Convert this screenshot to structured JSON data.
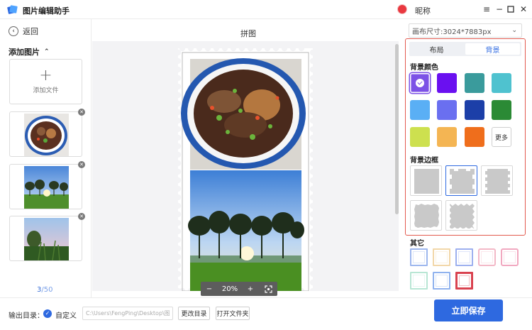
{
  "app": {
    "title": "图片编辑助手",
    "user_name": "昵称"
  },
  "window_controls": [
    "menu",
    "minimize",
    "maximize",
    "close"
  ],
  "left_panel": {
    "back_label": "返回",
    "add_images_label": "添加图片",
    "add_file_label": "添加文件",
    "thumbnails": [
      "food-bowl-photo",
      "sunset-trees-photo",
      "corn-field-photo"
    ],
    "page_current": "3",
    "page_total": "/50"
  },
  "canvas": {
    "title": "拼图",
    "zoom_minus": "−",
    "zoom_level": "20%",
    "zoom_plus": "+"
  },
  "bottom_bar": {
    "output_label": "输出目录：",
    "custom_label": "自定义",
    "path_value": "C:\\Users\\FengPing\\Desktop\\图片",
    "change_dir_label": "更改目录",
    "open_folder_label": "打开文件夹",
    "save_label": "立即保存"
  },
  "right_panel": {
    "canvas_size": "画布尺寸:3024*7883px",
    "tabs": [
      {
        "label": "布局"
      },
      {
        "label": "背景"
      }
    ],
    "active_tab": "背景",
    "bg_color_title": "背景颜色",
    "bg_colors": [
      "#7c52e6",
      "#6a10f0",
      "#3a9b9c",
      "#4fc2cf",
      "#5aaff5",
      "#6a6ff0",
      "#1c3fa8",
      "#2b8a35",
      "#cde04f",
      "#f4b553",
      "#ef6e1c"
    ],
    "selected_color": "#7c52e6",
    "more_label": "更多",
    "bg_border_title": "背景边框",
    "other_title": "其它",
    "frame_colors": [
      "#9db7ee",
      "#f2d7a8",
      "#9db0ef",
      "#f3b8c7",
      "#f1a8c0",
      "#b8e6d4",
      "#8fb2ee",
      "#d9424f"
    ]
  }
}
